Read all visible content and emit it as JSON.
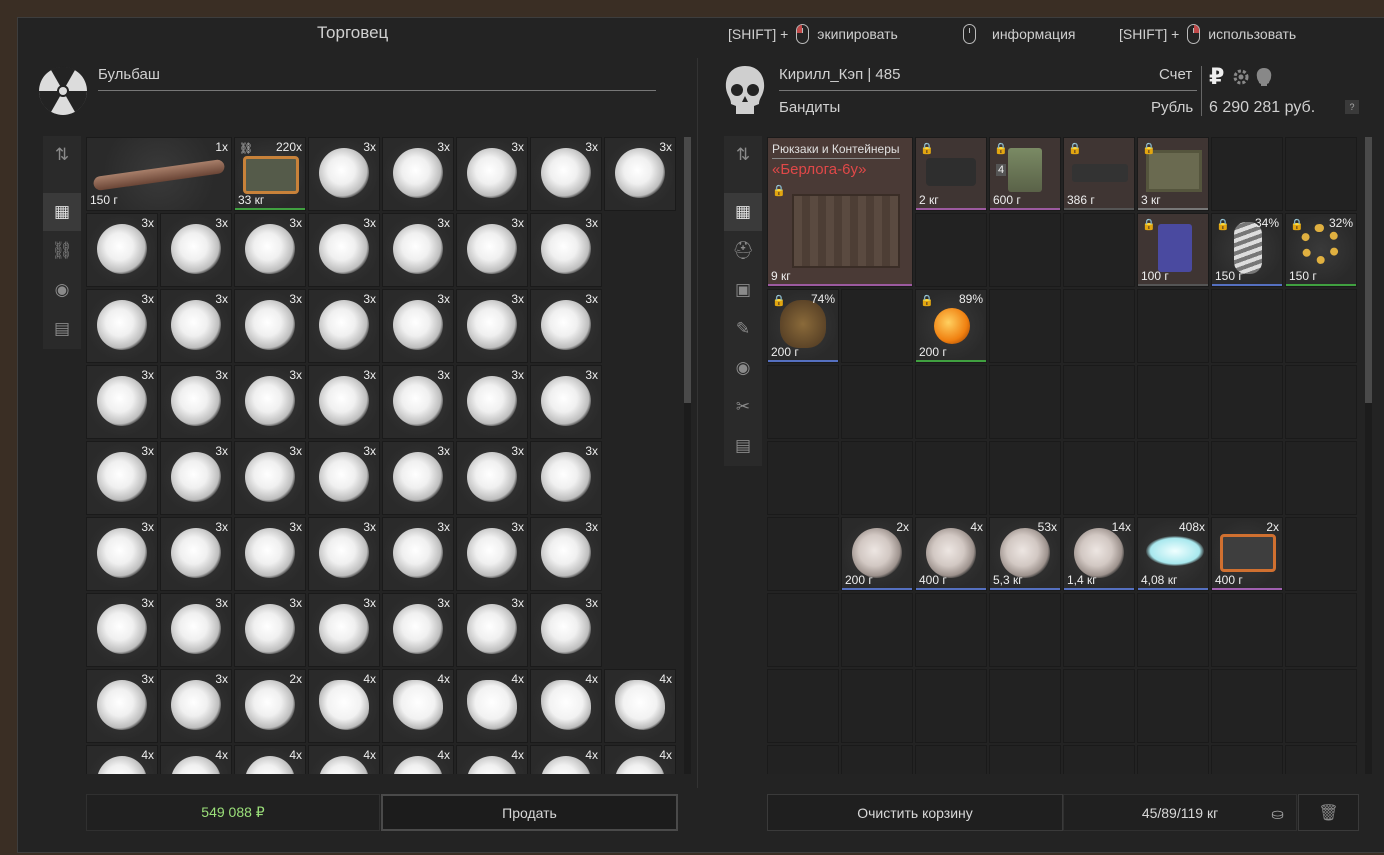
{
  "header": {
    "title": "Торговец",
    "hints": [
      {
        "prefix": "[SHIFT] +",
        "label": "экипировать"
      },
      {
        "prefix": "",
        "label": "информация"
      },
      {
        "prefix": "[SHIFT] +",
        "label": "использовать"
      }
    ]
  },
  "trader": {
    "name": "Бульбаш",
    "total": "549 088 ₽",
    "sell_label": "Продать"
  },
  "player": {
    "name": "Кирилл_Кэп | 485",
    "faction": "Бандиты",
    "account_label": "Счет",
    "currency_label": "Рубль",
    "balance": "6 290 281 руб.",
    "help": "?",
    "currency_icon": "₽",
    "clear_label": "Очистить корзину",
    "weight": "45/89/119 кг"
  },
  "trader_grid": {
    "row0": [
      {
        "q": "1x",
        "w": "150 г",
        "kind": "bone"
      },
      {
        "q": "220x",
        "w": "33 кг",
        "kind": "case"
      },
      {
        "q": "3x"
      },
      {
        "q": "3x"
      },
      {
        "q": "3x"
      },
      {
        "q": "3x"
      },
      {
        "q": "3x"
      }
    ],
    "rows": [
      [
        "3x",
        "3x",
        "3x",
        "3x",
        "3x",
        "3x",
        "3x"
      ],
      [
        "3x",
        "3x",
        "3x",
        "3x",
        "3x",
        "3x",
        "3x"
      ],
      [
        "3x",
        "3x",
        "3x",
        "3x",
        "3x",
        "3x",
        "3x"
      ],
      [
        "3x",
        "3x",
        "3x",
        "3x",
        "3x",
        "3x",
        "3x"
      ],
      [
        "3x",
        "3x",
        "3x",
        "3x",
        "3x",
        "3x",
        "3x"
      ],
      [
        "3x",
        "3x",
        "3x",
        "3x",
        "3x",
        "3x",
        "3x"
      ]
    ],
    "row7": [
      {
        "q": "3x",
        "s": false
      },
      {
        "q": "3x",
        "s": false
      },
      {
        "q": "2x",
        "s": false
      },
      {
        "q": "4x",
        "s": true
      },
      {
        "q": "4x",
        "s": true
      },
      {
        "q": "4x",
        "s": true
      },
      {
        "q": "4x",
        "s": true
      },
      {
        "q": "4x",
        "s": true
      }
    ],
    "row8": [
      "4x",
      "4x",
      "4x",
      "4x",
      "4x",
      "4x",
      "4x",
      "4x"
    ]
  },
  "container": {
    "category": "Рюкзаки и Контейнеры",
    "name": "«Берлога-6у»",
    "weight": "9 кг"
  },
  "player_items": [
    {
      "col": 2,
      "row": 0,
      "w": "2 кг",
      "kind": "cam",
      "bar": "#9c5aa0"
    },
    {
      "col": 3,
      "row": 0,
      "w": "600 г",
      "kind": "cash",
      "bar": "#9c5aa0",
      "badge": "4"
    },
    {
      "col": 4,
      "row": 0,
      "w": "386 г",
      "kind": "gun",
      "bar": "#555"
    },
    {
      "col": 5,
      "row": 0,
      "w": "3 кг",
      "kind": "pda",
      "bar": "#777"
    },
    {
      "col": 5,
      "row": 1,
      "w": "100 г",
      "kind": "box",
      "bar": "#555"
    },
    {
      "col": 6,
      "row": 1,
      "w": "150 г",
      "p": "34%",
      "kind": "spiral",
      "bar": "#5570c0"
    },
    {
      "col": 7,
      "row": 1,
      "w": "150 г",
      "p": "32%",
      "kind": "ring",
      "bar": "#40a040"
    },
    {
      "col": 0,
      "row": 2,
      "w": "200 г",
      "p": "74%",
      "kind": "bag",
      "bar": "#5570c0"
    },
    {
      "col": 2,
      "row": 2,
      "w": "200 г",
      "p": "89%",
      "kind": "orb",
      "bar": "#40a040"
    },
    {
      "col": 1,
      "row": 5,
      "w": "200 г",
      "q": "2x",
      "kind": "tblob",
      "bar": "#5570c0"
    },
    {
      "col": 2,
      "row": 5,
      "w": "400 г",
      "q": "4x",
      "kind": "tblob",
      "bar": "#5570c0"
    },
    {
      "col": 3,
      "row": 5,
      "w": "5,3 кг",
      "q": "53x",
      "kind": "tblob",
      "bar": "#5570c0"
    },
    {
      "col": 4,
      "row": 5,
      "w": "1,4 кг",
      "q": "14x",
      "kind": "tblob",
      "bar": "#5570c0"
    },
    {
      "col": 5,
      "row": 5,
      "w": "4,08 кг",
      "q": "408x",
      "kind": "crystals",
      "bar": "#5570c0"
    },
    {
      "col": 6,
      "row": 5,
      "w": "400 г",
      "q": "2x",
      "kind": "case2",
      "bar": "#a060b0"
    }
  ]
}
